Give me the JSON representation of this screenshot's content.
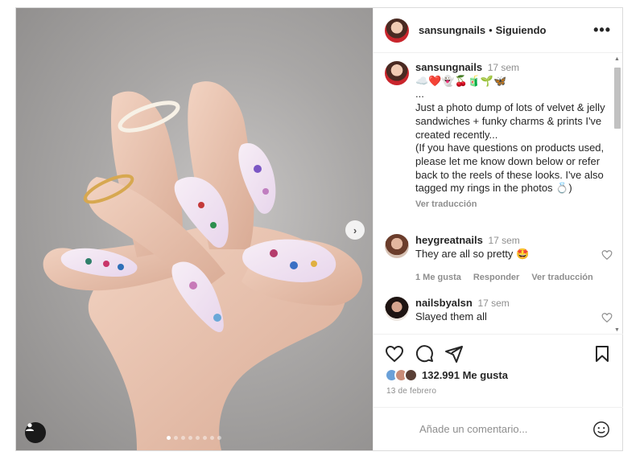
{
  "header": {
    "username": "sansungnails",
    "separator": "•",
    "follow_status": "Siguiendo",
    "more_label": "•••"
  },
  "caption": {
    "username": "sansungnails",
    "time": "17 sem",
    "emojis": "☁️❤️👻🍒🧃🌱🦋",
    "text": "...\nJust a photo dump of lots of velvet & jelly sandwiches + funky charms & prints I've created recently...\n(If you have questions on products used, please let me know down below or refer back to the reels of these looks. I've also tagged my rings in the photos 💍)",
    "translate": "Ver traducción"
  },
  "comments": [
    {
      "username": "heygreatnails",
      "time": "17 sem",
      "text": "They are all so pretty 🤩",
      "likes": "1 Me gusta",
      "reply": "Responder",
      "translate": "Ver traducción"
    },
    {
      "username": "nailsbyalsn",
      "time": "17 sem",
      "text": "Slayed them all"
    }
  ],
  "likes": {
    "count": "132.991 Me gusta"
  },
  "date": "13 de febrero",
  "add_comment": {
    "placeholder": "Añade un comentario..."
  },
  "carousel": {
    "total_slides": 8,
    "active_slide": 1
  },
  "icons": {
    "like": "heart-icon",
    "comment": "comment-icon",
    "share": "send-icon",
    "save": "bookmark-icon",
    "emoji": "emoji-icon",
    "next": "chevron-right-icon",
    "tags": "user-tag-icon"
  }
}
